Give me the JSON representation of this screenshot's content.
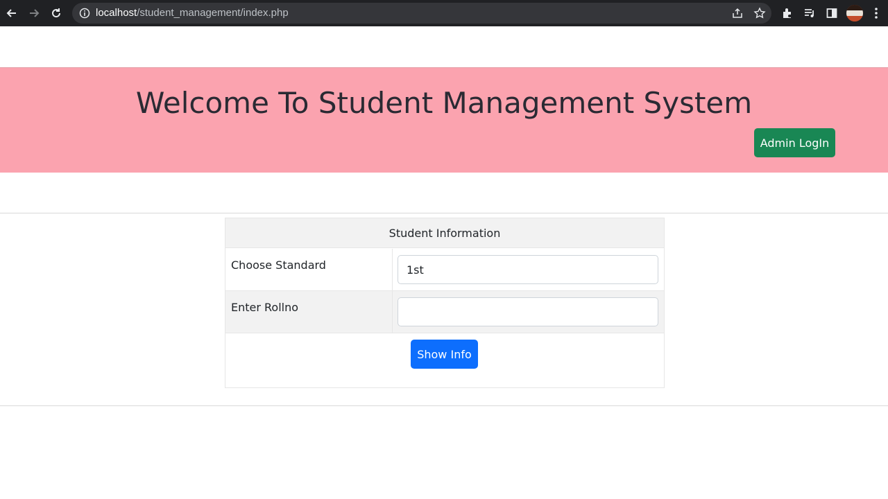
{
  "browser": {
    "url_host": "localhost",
    "url_path": "/student_management/index.php"
  },
  "banner": {
    "title": "Welcome To Student Management System",
    "admin_login_label": "Admin LogIn"
  },
  "form": {
    "header": "Student Information",
    "standard_label": "Choose Standard",
    "standard_value": "1st",
    "rollno_label": "Enter Rollno",
    "rollno_value": "",
    "show_info_label": "Show Info"
  },
  "colors": {
    "banner_bg": "#fba3af",
    "admin_button": "#198754",
    "primary_button": "#0d6efd"
  }
}
